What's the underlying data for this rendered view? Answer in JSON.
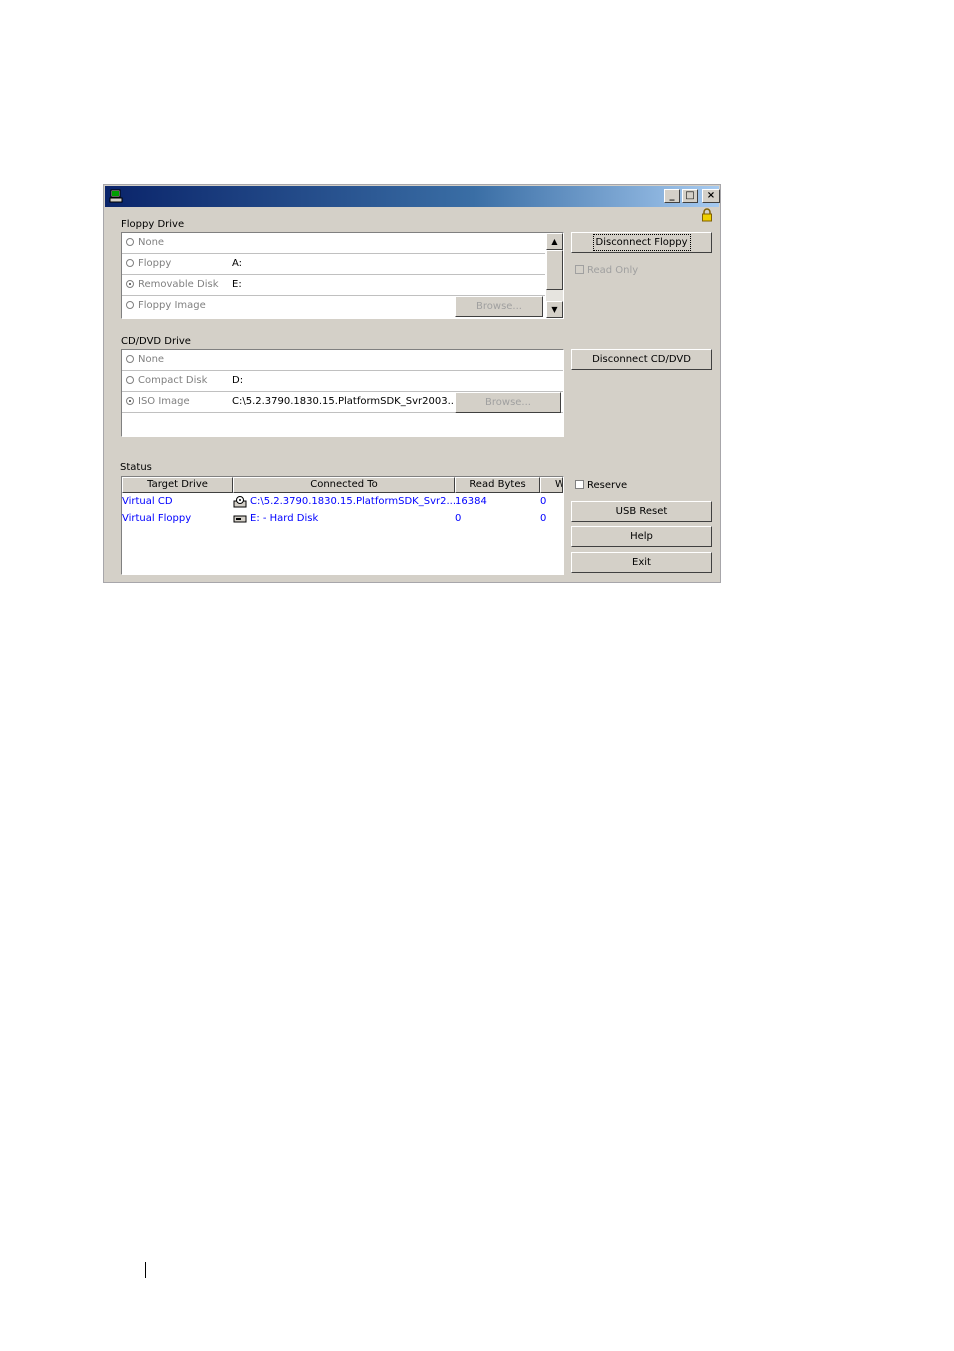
{
  "window": {
    "title": "",
    "controls": {
      "minimize": "_",
      "maximize": "□",
      "close": "×"
    },
    "icons": {
      "app": "vm-app-icon",
      "lock": "lock-icon"
    }
  },
  "floppy": {
    "label": "Floppy Drive",
    "options": [
      {
        "label": "None",
        "value": "",
        "selected": false
      },
      {
        "label": "Floppy",
        "value": "A:",
        "selected": false
      },
      {
        "label": "Removable Disk",
        "value": "E:",
        "selected": true
      },
      {
        "label": "Floppy Image",
        "value": "",
        "selected": false
      }
    ],
    "browse_label": "Browse...",
    "disconnect_label": "Disconnect Floppy",
    "readonly_label": "Read Only"
  },
  "cddvd": {
    "label": "CD/DVD Drive",
    "options": [
      {
        "label": "None",
        "value": "",
        "selected": false
      },
      {
        "label": "Compact Disk",
        "value": "D:",
        "selected": false
      },
      {
        "label": "ISO Image",
        "value": "C:\\5.2.3790.1830.15.PlatformSDK_Svr2003...",
        "selected": true
      }
    ],
    "browse_label": "Browse...",
    "disconnect_label": "Disconnect CD/DVD"
  },
  "status": {
    "label": "Status",
    "columns": [
      "Target Drive",
      "Connected To",
      "Read Bytes",
      "W"
    ],
    "rows": [
      {
        "target": "Virtual CD",
        "connected": "C:\\5.2.3790.1830.15.PlatformSDK_Svr2...",
        "read": "16384",
        "write": "0",
        "icon": "cd-drive-icon"
      },
      {
        "target": "Virtual Floppy",
        "connected": "E: - Hard Disk",
        "read": "0",
        "write": "0",
        "icon": "hard-disk-icon"
      }
    ]
  },
  "actions": {
    "reserve_label": "Reserve",
    "usb_reset_label": "USB Reset",
    "help_label": "Help",
    "exit_label": "Exit"
  }
}
